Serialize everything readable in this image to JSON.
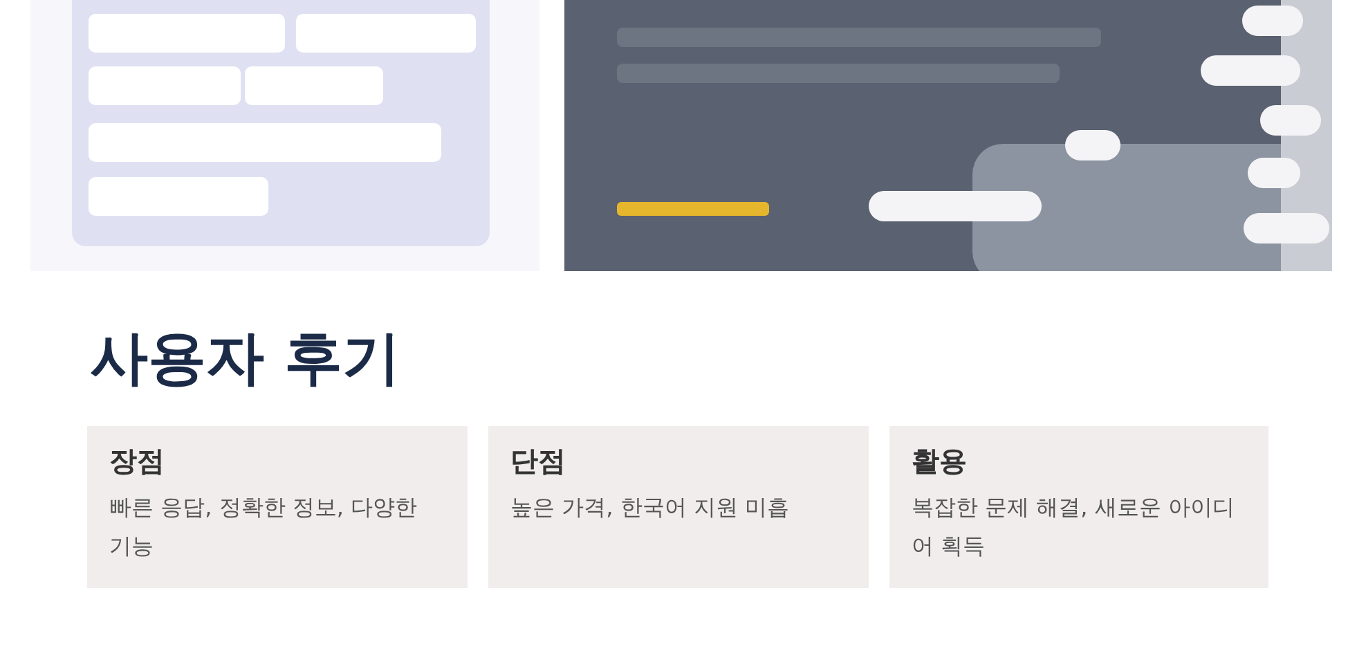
{
  "section": {
    "title": "사용자 후기",
    "cards": [
      {
        "title": "장점",
        "body": "빠른 응답, 정확한 정보, 다양한 기능"
      },
      {
        "title": "단점",
        "body": "높은 가격, 한국어 지원 미흡"
      },
      {
        "title": "활용",
        "body": "복잡한 문제 해결, 새로운 아이디어 획득"
      }
    ]
  }
}
